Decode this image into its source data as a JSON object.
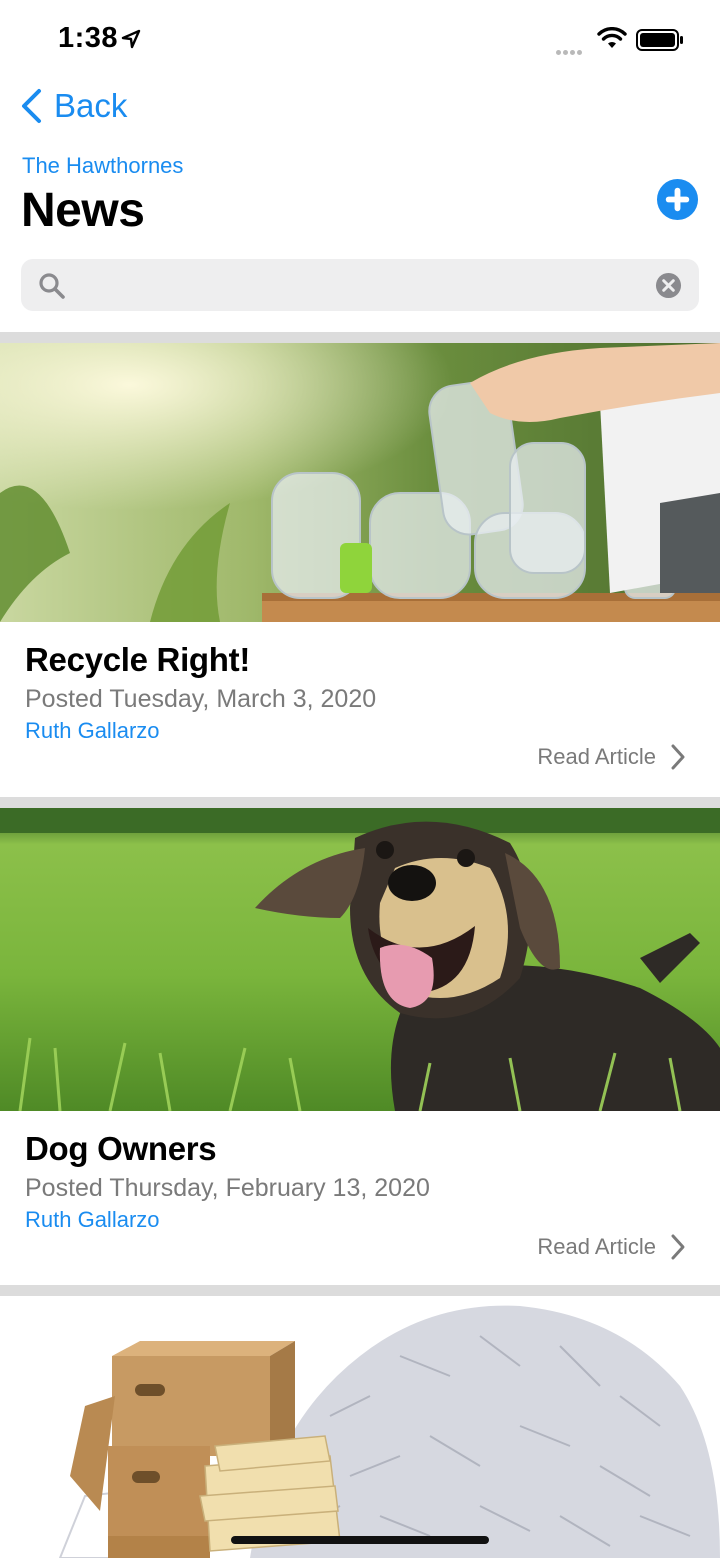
{
  "status_bar": {
    "time": "1:38"
  },
  "nav": {
    "back_label": "Back"
  },
  "header": {
    "community": "The Hawthornes",
    "title": "News"
  },
  "search": {
    "placeholder": "",
    "value": ""
  },
  "articles": [
    {
      "title": "Recycle Right!",
      "date": "Posted Tuesday, March 3, 2020",
      "author": "Ruth Gallarzo",
      "read_label": "Read Article",
      "image": "recycling-bottles-photo"
    },
    {
      "title": "Dog Owners",
      "date": "Posted Thursday, February 13, 2020",
      "author": "Ruth Gallarzo",
      "read_label": "Read Article",
      "image": "dog-in-grass-photo"
    },
    {
      "image": "shredded-paper-boxes-photo"
    }
  ],
  "colors": {
    "accent": "#1a8cf0",
    "divider": "#dcdcdc",
    "secondary_text": "#7a7a7a",
    "search_bg": "#eeeeef"
  },
  "icons": [
    "location-arrow-icon",
    "signal-icon",
    "wifi-icon",
    "battery-icon",
    "chevron-left-icon",
    "plus-circle-icon",
    "search-icon",
    "clear-icon",
    "chevron-right-icon"
  ]
}
